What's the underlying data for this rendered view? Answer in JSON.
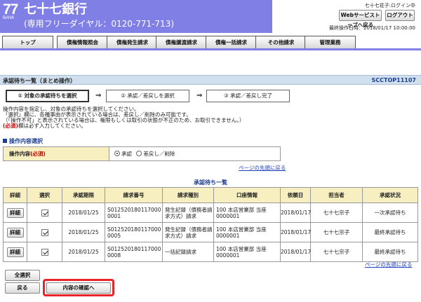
{
  "header": {
    "logo_number": "77",
    "logo_bank": "BANK",
    "bank_name": "七十七銀行",
    "phone": "(専用フリーダイヤル：0120-771-713)",
    "user_status": "七十七花子:ログイン中",
    "webtop_button": "Webサービストップへ戻る",
    "logout_button": "ログアウト",
    "last_operation": "最終操作日時：2018/01/17 10:00:00",
    "banner_color": "#7f7fe6"
  },
  "tabs": [
    "トップ",
    "債権情報照会",
    "債権発生請求",
    "債権譲渡請求",
    "債権一括請求",
    "その他請求",
    "管理業務"
  ],
  "page": {
    "title": "承認待ち一覧（まとめ操作）",
    "screen_id": "SCCTOP11107"
  },
  "steps": [
    "① 対象の承認待ちを選択",
    "② 承認／差戻しを選択",
    "③ 承認／差戻し完了"
  ],
  "instructions": [
    "操作内容を指定し、対象の承認待ちを選択してください。",
    "「選択」欄に、各種事由が表示されている場合は、差戻し／削除のみ可能です。",
    "（「操作不可」と表示されている場合は、権限もしくは取引の状態が不正のため、お取引できません。）"
  ],
  "required_tag": "(必須)",
  "required_note": "欄は必ず入力してください。",
  "op_section": {
    "heading": "操作内容選択",
    "label": "操作内容",
    "required_tag": "(必須)",
    "option_approve": "承認",
    "option_reject": "差戻し／削除",
    "selected": "承認"
  },
  "page_top_link": "ページの先頭に戻る",
  "list": {
    "title": "承認待ち一覧",
    "headers": [
      "詳細",
      "選択",
      "承認期限",
      "請求番号",
      "請求種別",
      "口座情報",
      "依頼日",
      "担当者",
      "承認状況"
    ],
    "detail_button": "詳細",
    "rows": [
      {
        "checked": true,
        "deadline": "2018/01/25",
        "request_no": "S0125201801170000001",
        "type": "発生記録（債務者請求方式）請求",
        "account": "100 本店営業部 当座 0000001",
        "request_date": "2018/01/17",
        "person": "七十七宗子",
        "status": "一次承認待ち"
      },
      {
        "checked": true,
        "deadline": "2018/01/25",
        "request_no": "S0125201801170000005",
        "type": "発生記録（債務者請求方式）請求",
        "account": "100 本店営業部 当座 0000001",
        "request_date": "2018/01/17",
        "person": "七十七宗子",
        "status": "最終承認待ち"
      },
      {
        "checked": true,
        "deadline": "2018/01/25",
        "request_no": "S0125201801170000008",
        "type": "一括記録請求",
        "account": "100 本店営業部 当座 0000001",
        "request_date": "2018/01/17",
        "person": "七十七宗子",
        "status": "最終承認待ち"
      }
    ]
  },
  "buttons": {
    "select_all": "全選択",
    "back": "戻る",
    "confirm": "内容の確認へ"
  },
  "colors": {
    "accent": "#7f7fe6",
    "highlight": "#e8242a",
    "label_bg": "#f7efc0"
  }
}
